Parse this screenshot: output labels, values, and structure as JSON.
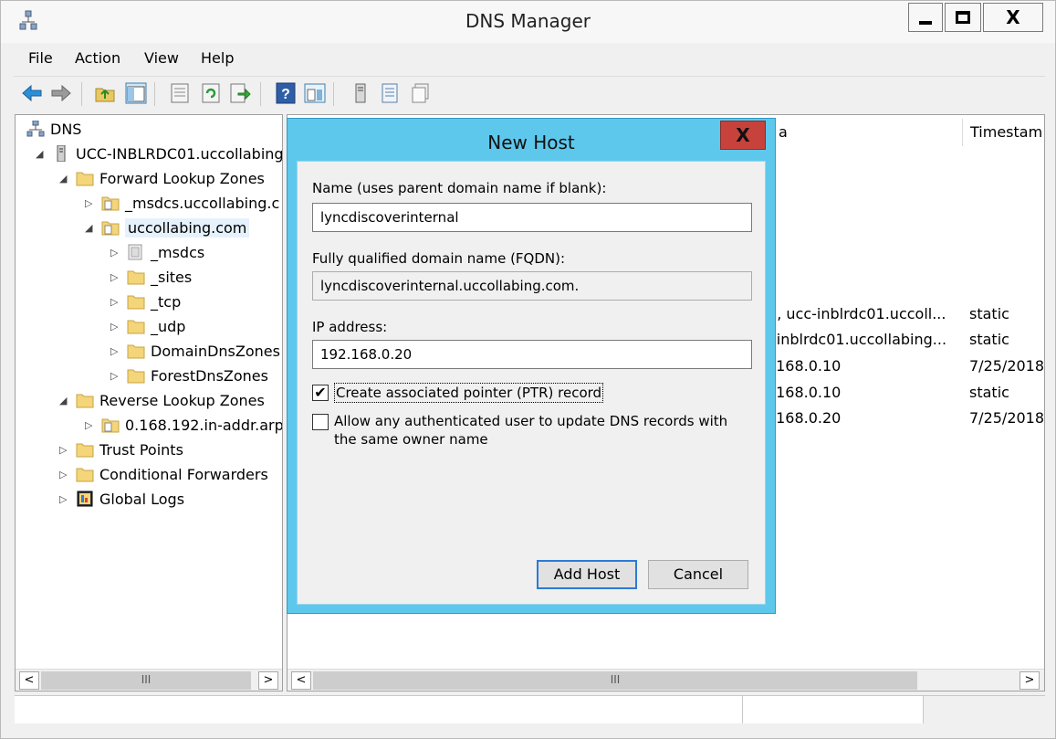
{
  "window": {
    "title": "DNS Manager",
    "controls": {
      "minimize": "",
      "maximize": "",
      "close": "X"
    }
  },
  "menu": [
    {
      "label": "File"
    },
    {
      "label": "Action"
    },
    {
      "label": "View"
    },
    {
      "label": "Help"
    }
  ],
  "toolbar": {
    "icons": [
      "back-arrow-icon",
      "forward-arrow-icon",
      "up-folder-icon",
      "show-hide-console-tree-icon",
      "properties-icon",
      "refresh-icon",
      "export-list-icon",
      "help-icon",
      "action-pane-icon",
      "server-icon",
      "list-view-icon",
      "detail-view-icon"
    ]
  },
  "tree": {
    "items": [
      {
        "label": "DNS",
        "expander": ""
      },
      {
        "label": "UCC-INBLRDC01.uccollabing",
        "expander": "◢"
      },
      {
        "label": "Forward Lookup Zones",
        "expander": "◢"
      },
      {
        "label": "_msdcs.uccollabing.c",
        "expander": "▷"
      },
      {
        "label": "uccollabing.com",
        "expander": "◢"
      },
      {
        "label": "_msdcs",
        "expander": "▷"
      },
      {
        "label": "_sites",
        "expander": "▷"
      },
      {
        "label": "_tcp",
        "expander": "▷"
      },
      {
        "label": "_udp",
        "expander": "▷"
      },
      {
        "label": "DomainDnsZones",
        "expander": "▷"
      },
      {
        "label": "ForestDnsZones",
        "expander": "▷"
      },
      {
        "label": "Reverse Lookup Zones",
        "expander": "◢"
      },
      {
        "label": "0.168.192.in-addr.arp",
        "expander": "▷"
      },
      {
        "label": "Trust Points",
        "expander": "▷"
      },
      {
        "label": "Conditional Forwarders",
        "expander": "▷"
      },
      {
        "label": "Global Logs",
        "expander": "▷"
      }
    ]
  },
  "list": {
    "columns": [
      {
        "label": "a"
      },
      {
        "label": "Timestam"
      }
    ],
    "rows": [
      {
        "data": "], ucc-inblrdc01.uccoll...",
        "timestamp": "static"
      },
      {
        "data": "-inblrdc01.uccollabing...",
        "timestamp": "static"
      },
      {
        "data": ".168.0.10",
        "timestamp": "7/25/2018"
      },
      {
        "data": ".168.0.10",
        "timestamp": "static"
      },
      {
        "data": ".168.0.20",
        "timestamp": "7/25/2018"
      }
    ]
  },
  "scrollbar": {
    "left_arrow": "<",
    "right_arrow": ">",
    "thumb_grip": "III"
  },
  "dialog": {
    "title": "New Host",
    "close_label": "X",
    "name_label": "Name (uses parent domain name if blank):",
    "name_value": "lyncdiscoverinternal",
    "fqdn_label": "Fully qualified domain name (FQDN):",
    "fqdn_value": "lyncdiscoverinternal.uccollabing.com.",
    "ip_label": "IP address:",
    "ip_value": "192.168.0.20",
    "ptr_checkbox": {
      "label": "Create associated pointer (PTR) record",
      "checked": true,
      "mark": "✔"
    },
    "auth_checkbox": {
      "label": "Allow any authenticated user to update DNS records with the same owner name",
      "checked": false,
      "mark": ""
    },
    "add_button": "Add Host",
    "cancel_button": "Cancel"
  }
}
